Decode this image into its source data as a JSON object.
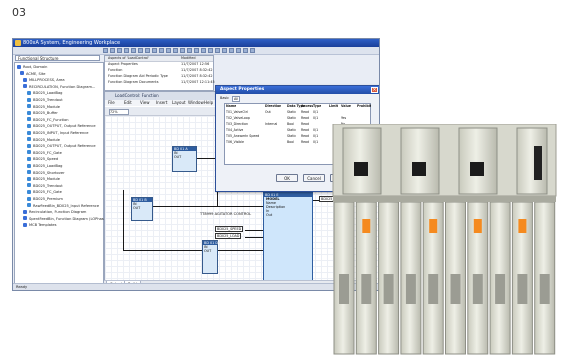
{
  "figure_number": "03",
  "window": {
    "title": "800xA System, Engineering Workplace",
    "combo_value": "Functional Structure",
    "toolbar_buttons": 22
  },
  "tree": {
    "items": [
      {
        "label": "Root, Domain",
        "color": "#3a6ed8"
      },
      {
        "label": "ACME, Site",
        "color": "#3a6ed8"
      },
      {
        "label": "MILLPROCESS, Area",
        "color": "#3a6ed8"
      },
      {
        "label": "RECIRCULATION, Function Diagram...",
        "color": "#3a6ed8"
      },
      {
        "label": "BD025_LoadBag",
        "color": "#3a8ad8"
      },
      {
        "label": "BD025_Trendout",
        "color": "#3a8ad8"
      },
      {
        "label": "BD025_Module",
        "color": "#3a8ad8"
      },
      {
        "label": "BD025_Buffer",
        "color": "#3a8ad8"
      },
      {
        "label": "BD025_FC_Function",
        "color": "#3a8ad8"
      },
      {
        "label": "BD025_OUTPUT, Output Reference",
        "color": "#3a8ad8"
      },
      {
        "label": "BD025_INPUT, Input Reference",
        "color": "#3a8ad8"
      },
      {
        "label": "BD025_Module",
        "color": "#3a8ad8"
      },
      {
        "label": "BD025_OUTPUT, Output Reference",
        "color": "#3a8ad8"
      },
      {
        "label": "BD025_FC_Gate",
        "color": "#3a8ad8"
      },
      {
        "label": "BD025_Speed",
        "color": "#3a8ad8"
      },
      {
        "label": "BD025_LoadBag",
        "color": "#3a8ad8"
      },
      {
        "label": "BD025_Shortover",
        "color": "#3a8ad8"
      },
      {
        "label": "BD025_Module",
        "color": "#3a8ad8"
      },
      {
        "label": "BD025_Trendout",
        "color": "#3a8ad8"
      },
      {
        "label": "BD025_FC_Gate",
        "color": "#3a8ad8"
      },
      {
        "label": "BD025_Premium",
        "color": "#3a8ad8"
      },
      {
        "label": "RawFeedBin_BD025_Input Reference",
        "color": "#3a8ad8"
      },
      {
        "label": "Recirculation, Function Diagram",
        "color": "#3a6ed8"
      },
      {
        "label": "SpentFeedBin, Function Diagram (LOPhase)",
        "color": "#3a6ed8"
      },
      {
        "label": "MCB Templates",
        "color": "#3a6ed8"
      }
    ]
  },
  "list_panel": {
    "headers": [
      "Aspects of 'LoadControl'",
      "Modified"
    ],
    "rows": [
      [
        "Aspect Properties",
        "11/7/2007 12:56"
      ],
      [
        "Function",
        "11/7/2007 8:32:42"
      ],
      [
        "Function Diagram Aid Periodic Type",
        "11/7/2007 8:32:42"
      ],
      [
        "Function Diagram Documents",
        "11/7/2007 12:11:45"
      ]
    ]
  },
  "editor": {
    "title": "LoadControl: Function",
    "menu": [
      "File",
      "Edit",
      "View",
      "Insert",
      "Layout",
      "Window",
      "Help"
    ],
    "zoom": "72%"
  },
  "diagram": {
    "blocks": [
      {
        "name": "main",
        "title": "BD 01 E",
        "subtitle": "MODEL",
        "rows": [
          "Name",
          "Description",
          "In",
          "Out"
        ]
      },
      {
        "name": "small-1",
        "title": "BD 01 B",
        "rows": [
          "IN",
          "OUT"
        ]
      },
      {
        "name": "small-2",
        "title": "BD 01 A",
        "rows": [
          "IN",
          "OUT",
          "PV"
        ]
      },
      {
        "name": "small-3",
        "title": "BD 01 D",
        "rows": [
          "IN",
          "OUT",
          "SP"
        ]
      }
    ],
    "labels": [
      "TT8999 AGITATOR CONTROL",
      "BD025_AGITAT",
      "BD025_SPEED",
      "BD025_LOAD"
    ]
  },
  "dialog": {
    "title": "Aspect Properties",
    "tabs": [
      "Basic",
      "All"
    ],
    "headers": [
      "Name",
      "Direction",
      "Data Type",
      "Access",
      "Type",
      "Limit",
      "Value",
      "Prohibit"
    ],
    "rows": [
      [
        "T01_ValveCtrl",
        "Out",
        "Static",
        "Read",
        "0/1",
        "",
        "",
        ""
      ],
      [
        "T02_ValveLoop",
        "",
        "Static",
        "Read",
        "0/1",
        "",
        "Yes",
        ""
      ],
      [
        "T03_Direction",
        "Internal",
        "Bool",
        "Read",
        "",
        "",
        "No",
        ""
      ],
      [
        "T04_Active",
        "",
        "Static",
        "Read",
        "0/1",
        "",
        "",
        ""
      ],
      [
        "T05_AnswerIn Speed",
        "",
        "Static",
        "Read",
        "0/1",
        "",
        "",
        ""
      ],
      [
        "T06_Visible",
        "",
        "Bool",
        "Read",
        "0/1",
        "",
        "",
        ""
      ]
    ],
    "ok_label": "OK",
    "cancel_label": "Cancel",
    "apply_label": "Apply"
  },
  "bottom_tabs": [
    "Output",
    "Build"
  ],
  "status_text": "Ready",
  "colors": {
    "title_blue": "#2d5fc6",
    "block_fill": "#cfe6fb",
    "orange_handle": "#f58a1f",
    "module_body": "#e7e8df"
  }
}
